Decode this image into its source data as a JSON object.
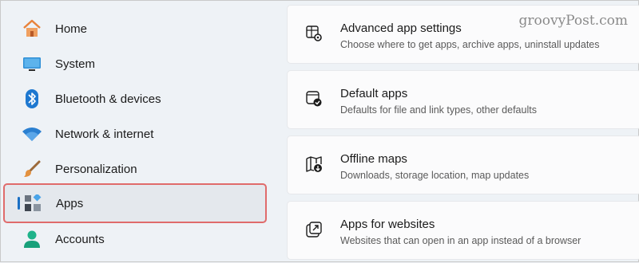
{
  "watermark": "groovyPost.com",
  "sidebar": {
    "items": [
      {
        "label": "Home",
        "icon": "home-icon"
      },
      {
        "label": "System",
        "icon": "monitor-icon"
      },
      {
        "label": "Bluetooth & devices",
        "icon": "bluetooth-icon"
      },
      {
        "label": "Network & internet",
        "icon": "wifi-icon"
      },
      {
        "label": "Personalization",
        "icon": "paintbrush-icon"
      },
      {
        "label": "Apps",
        "icon": "apps-icon",
        "selected": true
      },
      {
        "label": "Accounts",
        "icon": "person-icon"
      }
    ]
  },
  "cards": [
    {
      "title": "Advanced app settings",
      "subtitle": "Choose where to get apps, archive apps, uninstall updates",
      "icon": "app-settings-icon"
    },
    {
      "title": "Default apps",
      "subtitle": "Defaults for file and link types, other defaults",
      "icon": "default-apps-icon"
    },
    {
      "title": "Offline maps",
      "subtitle": "Downloads, storage location, map updates",
      "icon": "map-download-icon"
    },
    {
      "title": "Apps for websites",
      "subtitle": "Websites that can open in an app instead of a browser",
      "icon": "open-external-icon"
    }
  ],
  "colors": {
    "accent": "#1a6fc4",
    "highlight_border": "#e06b6b",
    "background": "#eef2f6",
    "card": "#fbfbfc"
  }
}
